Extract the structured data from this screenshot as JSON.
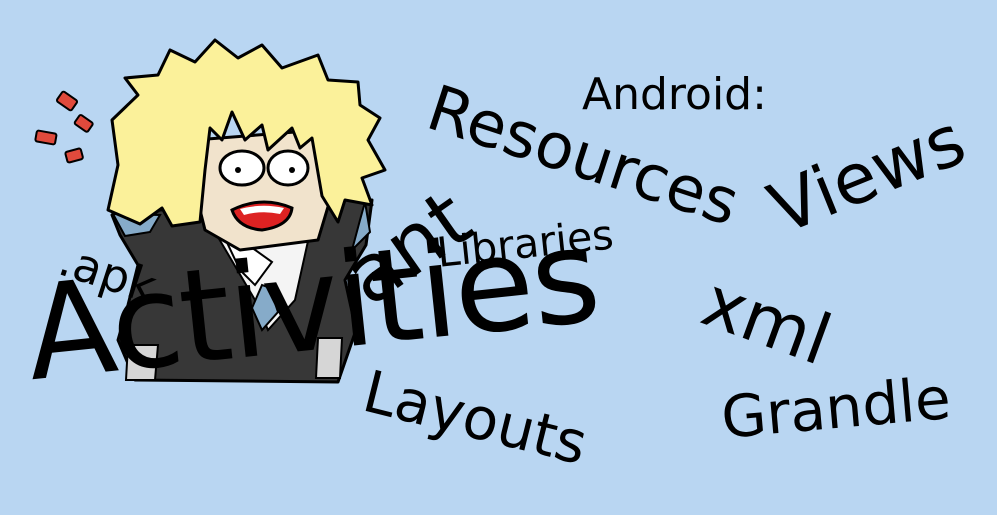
{
  "background_color": "#b9d6f2",
  "words": {
    "android": "Android:",
    "resources": "Resources",
    "views": "Views",
    "ant": "ant",
    "apk": ".apk",
    "libraries": "Libraries",
    "activities": "Activities",
    "xml": "xml",
    "layouts": "Layouts",
    "grandle": "Grandle"
  },
  "illustration": {
    "subject": "shocked-blond-cartoon-character",
    "hair_color": "#fbf19a",
    "skin_color": "#f1e3cc",
    "coat_color": "#373737",
    "tie_color": "#86abc9",
    "mouth_color": "#dd2222",
    "alarm_marks_color": "#e04a3c"
  }
}
